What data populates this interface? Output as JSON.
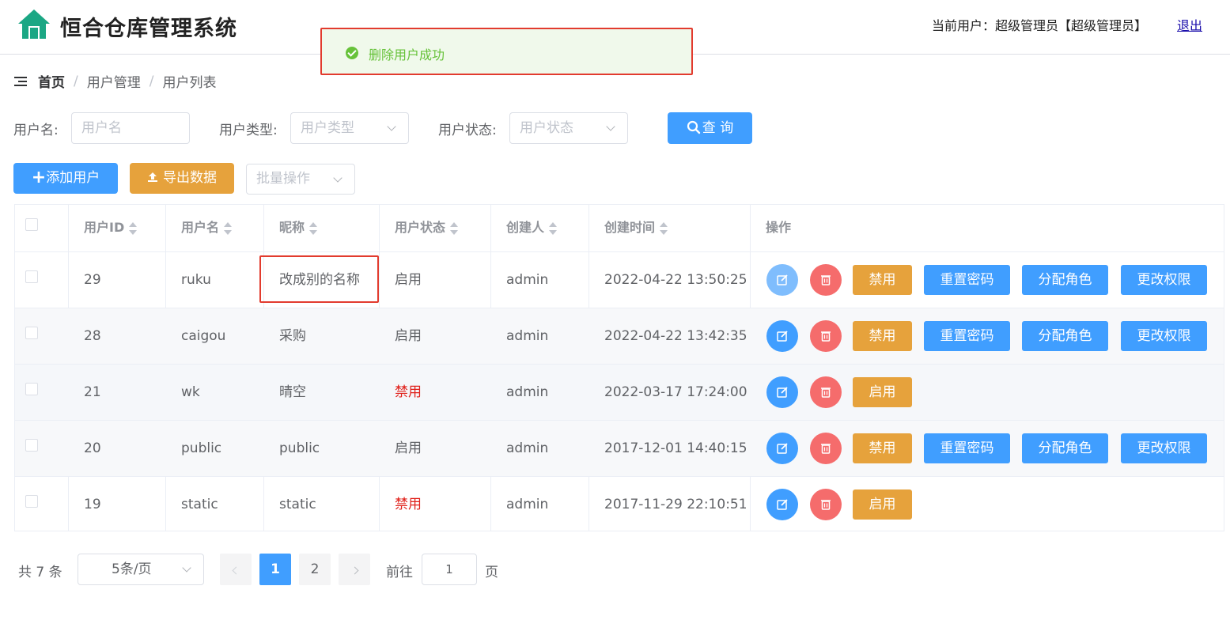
{
  "header": {
    "title": "恒合仓库管理系统",
    "user_info": "当前用户：超级管理员【超级管理员】",
    "logout": "退出"
  },
  "toast": {
    "message": "删除用户成功"
  },
  "breadcrumb": {
    "home": "首页",
    "items": [
      "用户管理",
      "用户列表"
    ]
  },
  "search": {
    "username_label": "用户名:",
    "username_placeholder": "用户名",
    "type_label": "用户类型:",
    "type_placeholder": "用户类型",
    "status_label": "用户状态:",
    "status_placeholder": "用户状态",
    "query_button": "查 询"
  },
  "toolbar": {
    "add_user": "添加用户",
    "export": "导出数据",
    "batch_placeholder": "批量操作"
  },
  "table": {
    "columns": [
      "用户ID",
      "用户名",
      "昵称",
      "用户状态",
      "创建人",
      "创建时间",
      "操作"
    ],
    "rows": [
      {
        "id": "29",
        "username": "ruku",
        "nickname": "改成别的名称",
        "status": "启用",
        "creator": "admin",
        "created": "2022-04-22 13:50:25",
        "toggle": "禁用",
        "reset": "重置密码",
        "assign": "分配角色",
        "perm": "更改权限"
      },
      {
        "id": "28",
        "username": "caigou",
        "nickname": "采购",
        "status": "启用",
        "creator": "admin",
        "created": "2022-04-22 13:42:35",
        "toggle": "禁用",
        "reset": "重置密码",
        "assign": "分配角色",
        "perm": "更改权限"
      },
      {
        "id": "21",
        "username": "wk",
        "nickname": "晴空",
        "status": "禁用",
        "creator": "admin",
        "created": "2022-03-17 17:24:00",
        "toggle": "启用"
      },
      {
        "id": "20",
        "username": "public",
        "nickname": "public",
        "status": "启用",
        "creator": "admin",
        "created": "2017-12-01 14:40:15",
        "toggle": "禁用",
        "reset": "重置密码",
        "assign": "分配角色",
        "perm": "更改权限"
      },
      {
        "id": "19",
        "username": "static",
        "nickname": "static",
        "status": "禁用",
        "creator": "admin",
        "created": "2017-11-29 22:10:51",
        "toggle": "启用"
      }
    ]
  },
  "pagination": {
    "total": "共 7 条",
    "page_size": "5条/页",
    "pages": [
      "1",
      "2"
    ],
    "current": "1",
    "goto_label": "前往",
    "goto_value": "1",
    "page_suffix": "页"
  },
  "colors": {
    "primary": "#409eff",
    "warning": "#e6a23c",
    "danger": "#f56c6c",
    "success": "#67c23a",
    "disabled_status": "#e0201a"
  }
}
